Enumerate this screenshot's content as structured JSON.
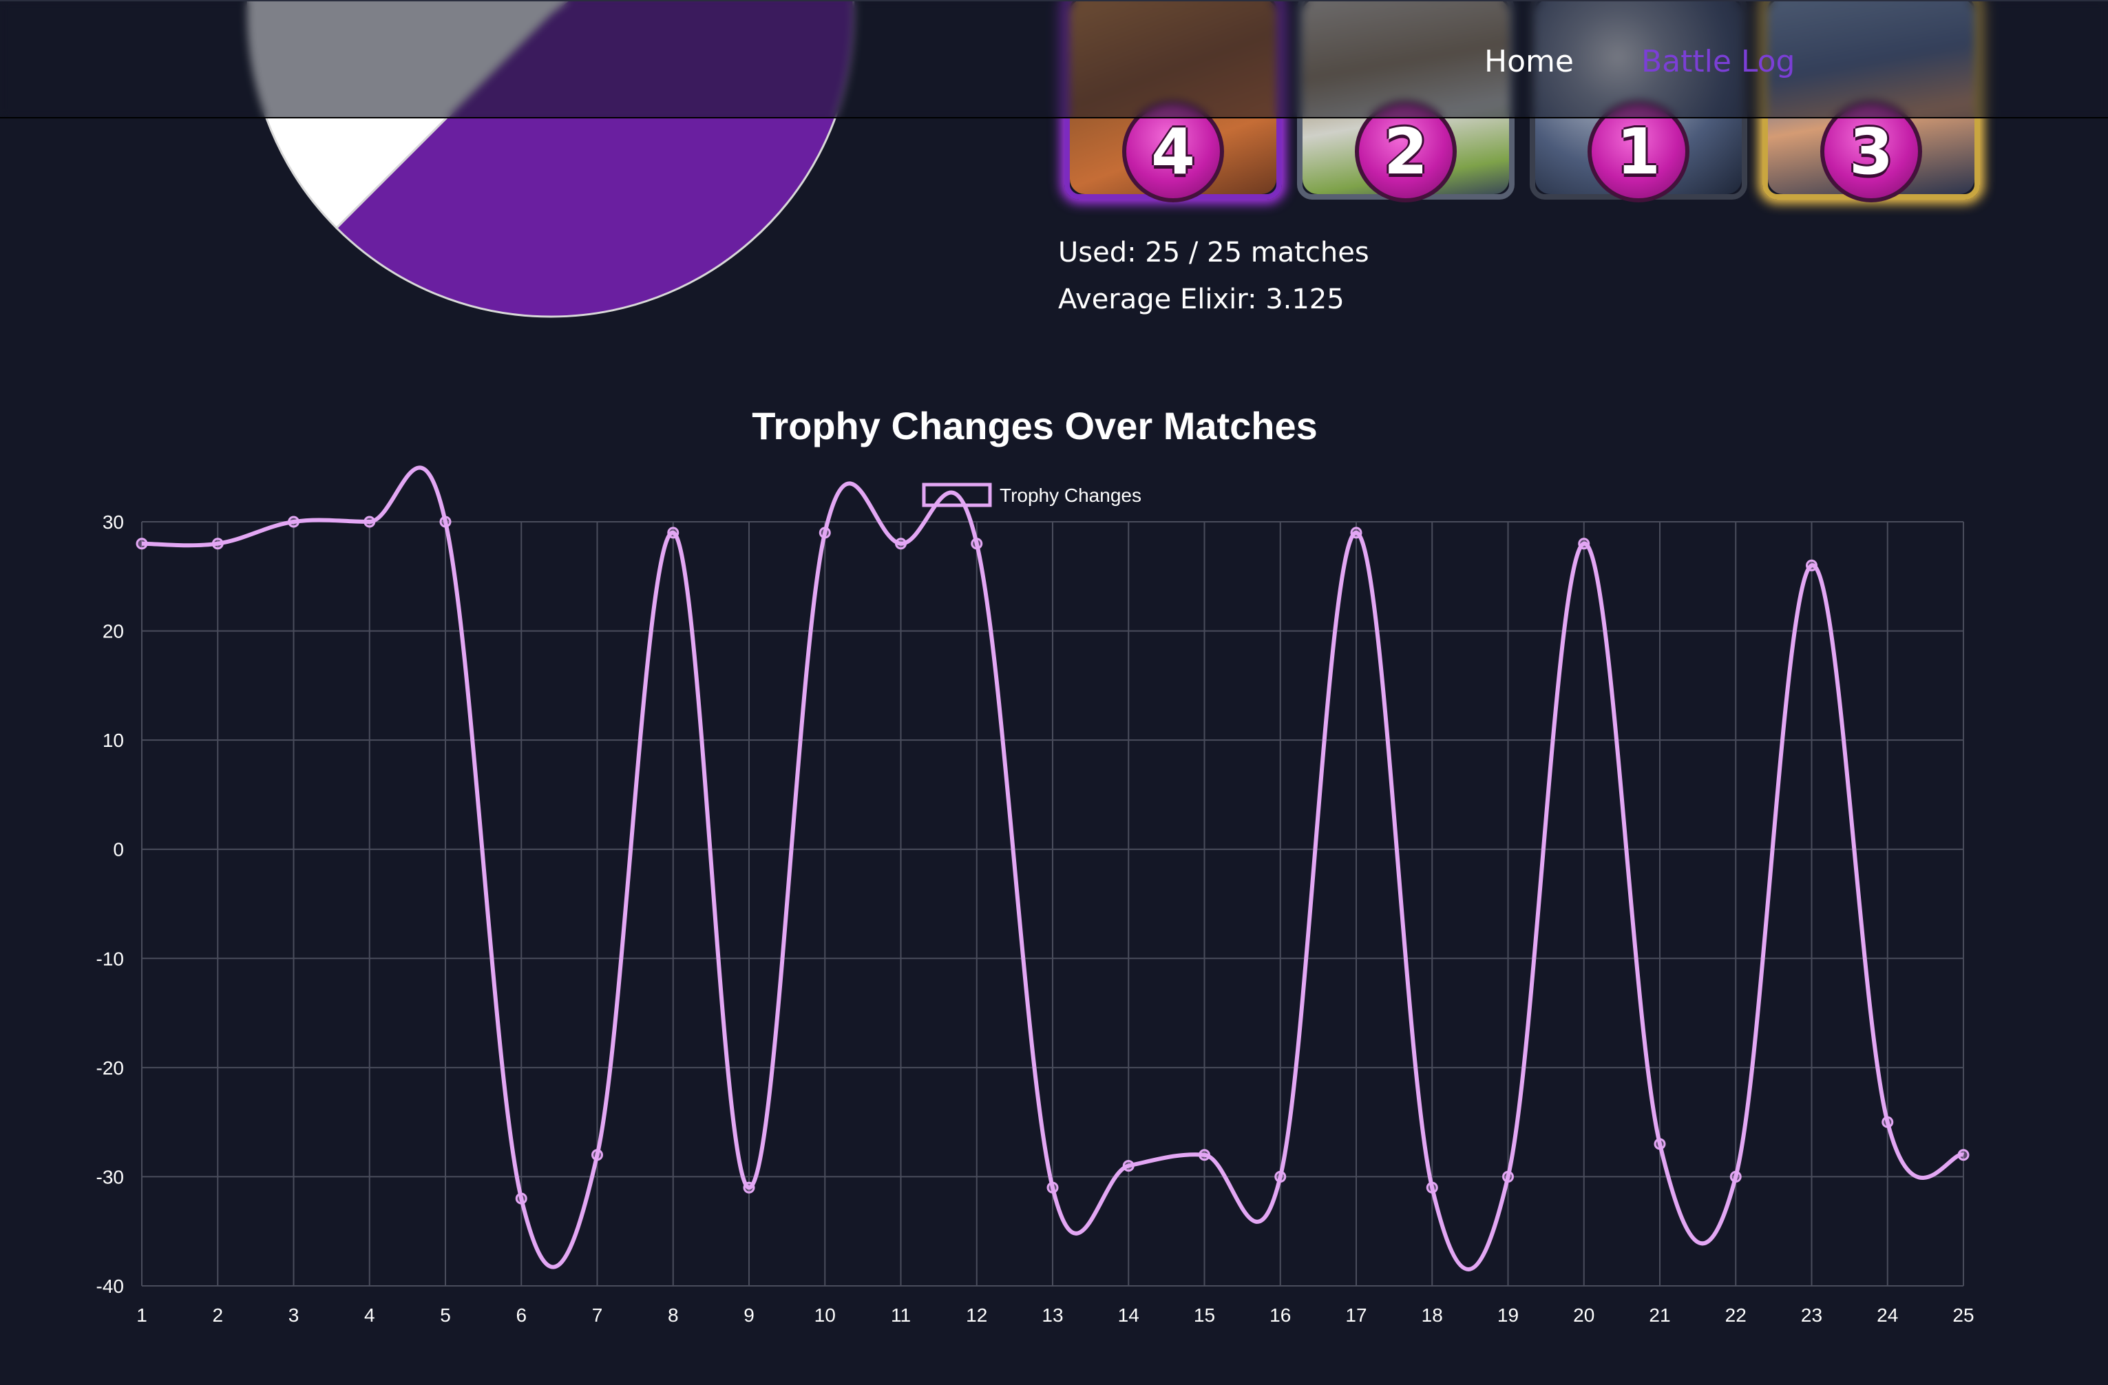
{
  "nav": {
    "home_label": "Home",
    "battle_log_label": "Battle Log"
  },
  "colors": {
    "background": "#141726",
    "accent_purple": "#6a1fa0",
    "line": "#e3a7f4",
    "nav_active": "#7b3fd6"
  },
  "pie": {
    "slices": [
      {
        "color": "#ffffff",
        "value": 0.52
      },
      {
        "color": "#6a1fa0",
        "value": 0.48
      }
    ]
  },
  "cards": [
    {
      "level": "4",
      "rarity": "epic"
    },
    {
      "level": "2",
      "rarity": "common"
    },
    {
      "level": "1",
      "rarity": "common"
    },
    {
      "level": "3",
      "rarity": "legendary"
    }
  ],
  "stats": {
    "used": "Used: 25 / 25 matches",
    "average_elixir": "Average Elixir: 3.125"
  },
  "chart_data": {
    "type": "line",
    "title": "Trophy Changes Over Matches",
    "xlabel": "",
    "ylabel": "",
    "x": [
      1,
      2,
      3,
      4,
      5,
      6,
      7,
      8,
      9,
      10,
      11,
      12,
      13,
      14,
      15,
      16,
      17,
      18,
      19,
      20,
      21,
      22,
      23,
      24,
      25
    ],
    "ylim": [
      -40,
      30
    ],
    "yticks": [
      30,
      20,
      10,
      0,
      -10,
      -20,
      -30,
      -40
    ],
    "grid": true,
    "legend_placement": "top",
    "series": [
      {
        "name": "Trophy Changes",
        "color": "#e3a7f4",
        "values": [
          28,
          28,
          30,
          30,
          30,
          -32,
          -28,
          29,
          -31,
          29,
          28,
          28,
          -31,
          -29,
          -28,
          -30,
          29,
          -31,
          -30,
          28,
          -27,
          -30,
          26,
          -25,
          -28
        ]
      }
    ]
  }
}
